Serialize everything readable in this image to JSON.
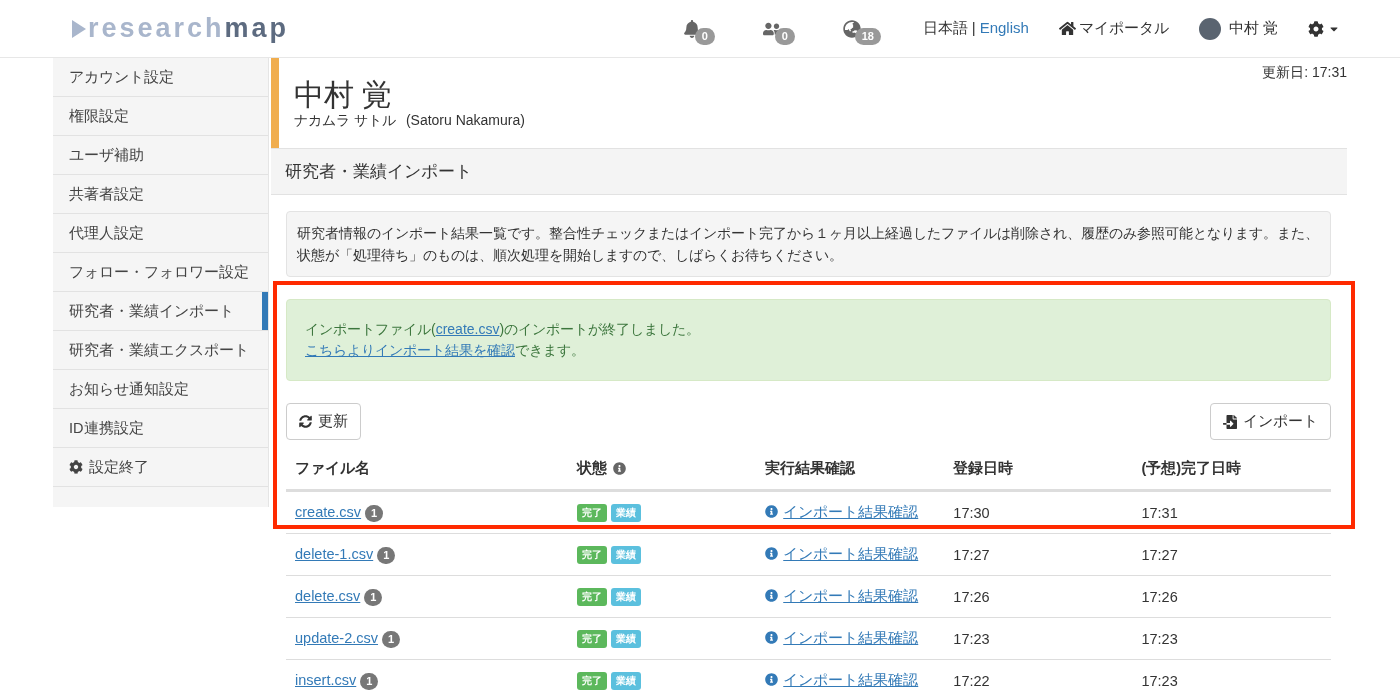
{
  "header": {
    "logo_parts": [
      "research",
      "map"
    ],
    "notifications": [
      {
        "kind": "bell",
        "count": "0"
      },
      {
        "kind": "users",
        "count": "0"
      },
      {
        "kind": "globe",
        "count": "18"
      }
    ],
    "language_separator": "|",
    "languages": [
      {
        "label": "日本語",
        "selected": true
      },
      {
        "label": "English",
        "selected": false
      }
    ],
    "portal": "マイポータル",
    "user": "中村 覚"
  },
  "sidebar": {
    "items": [
      {
        "label": "アカウント設定",
        "selected": false
      },
      {
        "label": "権限設定",
        "selected": false
      },
      {
        "label": "ユーザ補助",
        "selected": false
      },
      {
        "label": "共著者設定",
        "selected": false
      },
      {
        "label": "代理人設定",
        "selected": false
      },
      {
        "label": "フォロー・フォロワー設定",
        "selected": false
      },
      {
        "label": "研究者・業績インポート",
        "selected": true
      },
      {
        "label": "研究者・業績エクスポート",
        "selected": false
      },
      {
        "label": "お知らせ通知設定",
        "selected": false
      },
      {
        "label": "ID連携設定",
        "selected": false
      },
      {
        "label": "設定終了",
        "selected": false,
        "kind": "gear"
      }
    ]
  },
  "profile": {
    "updated": "更新日: 17:31",
    "name": "中村 覚",
    "kana": "ナカムラ サトル",
    "roman": "(Satoru Nakamura)"
  },
  "section_title": "研究者・業績インポート",
  "info": "研究者情報のインポート結果一覧です。整合性チェックまたはインポート完了から１ヶ月以上経過したファイルは削除され、履歴のみ参照可能となります。また、状態が「処理待ち」のものは、順次処理を開始しますので、しばらくお待ちください。",
  "alert": {
    "line1_before": "インポートファイル(",
    "line1_link": "create.csv",
    "line1_after": ")のインポートが終了しました。",
    "line2_link": "こちらよりインポート結果を確認",
    "line2_after": "できます。"
  },
  "highlight_frame": true,
  "buttons": {
    "refresh": "更新",
    "import": "インポート"
  },
  "table": {
    "columns": [
      "ファイル名",
      "状態",
      "実行結果確認",
      "登録日時",
      "(予想)完了日時"
    ],
    "rows": [
      {
        "file": "create.csv",
        "count": "1",
        "tags": [
          {
            "label": "完了",
            "color": "#5cb85c"
          },
          {
            "label": "業績",
            "color": "#5bc0de"
          }
        ],
        "result": "インポート結果確認",
        "registered": "17:30",
        "completed": "17:31"
      },
      {
        "file": "delete-1.csv",
        "count": "1",
        "tags": [
          {
            "label": "完了",
            "color": "#5cb85c"
          },
          {
            "label": "業績",
            "color": "#5bc0de"
          }
        ],
        "result": "インポート結果確認",
        "registered": "17:27",
        "completed": "17:27"
      },
      {
        "file": "delete.csv",
        "count": "1",
        "tags": [
          {
            "label": "完了",
            "color": "#5cb85c"
          },
          {
            "label": "業績",
            "color": "#5bc0de"
          }
        ],
        "result": "インポート結果確認",
        "registered": "17:26",
        "completed": "17:26"
      },
      {
        "file": "update-2.csv",
        "count": "1",
        "tags": [
          {
            "label": "完了",
            "color": "#5cb85c"
          },
          {
            "label": "業績",
            "color": "#5bc0de"
          }
        ],
        "result": "インポート結果確認",
        "registered": "17:23",
        "completed": "17:23"
      },
      {
        "file": "insert.csv",
        "count": "1",
        "tags": [
          {
            "label": "完了",
            "color": "#5cb85c"
          },
          {
            "label": "業績",
            "color": "#5bc0de"
          }
        ],
        "result": "インポート結果確認",
        "registered": "17:22",
        "completed": "17:23"
      }
    ]
  }
}
